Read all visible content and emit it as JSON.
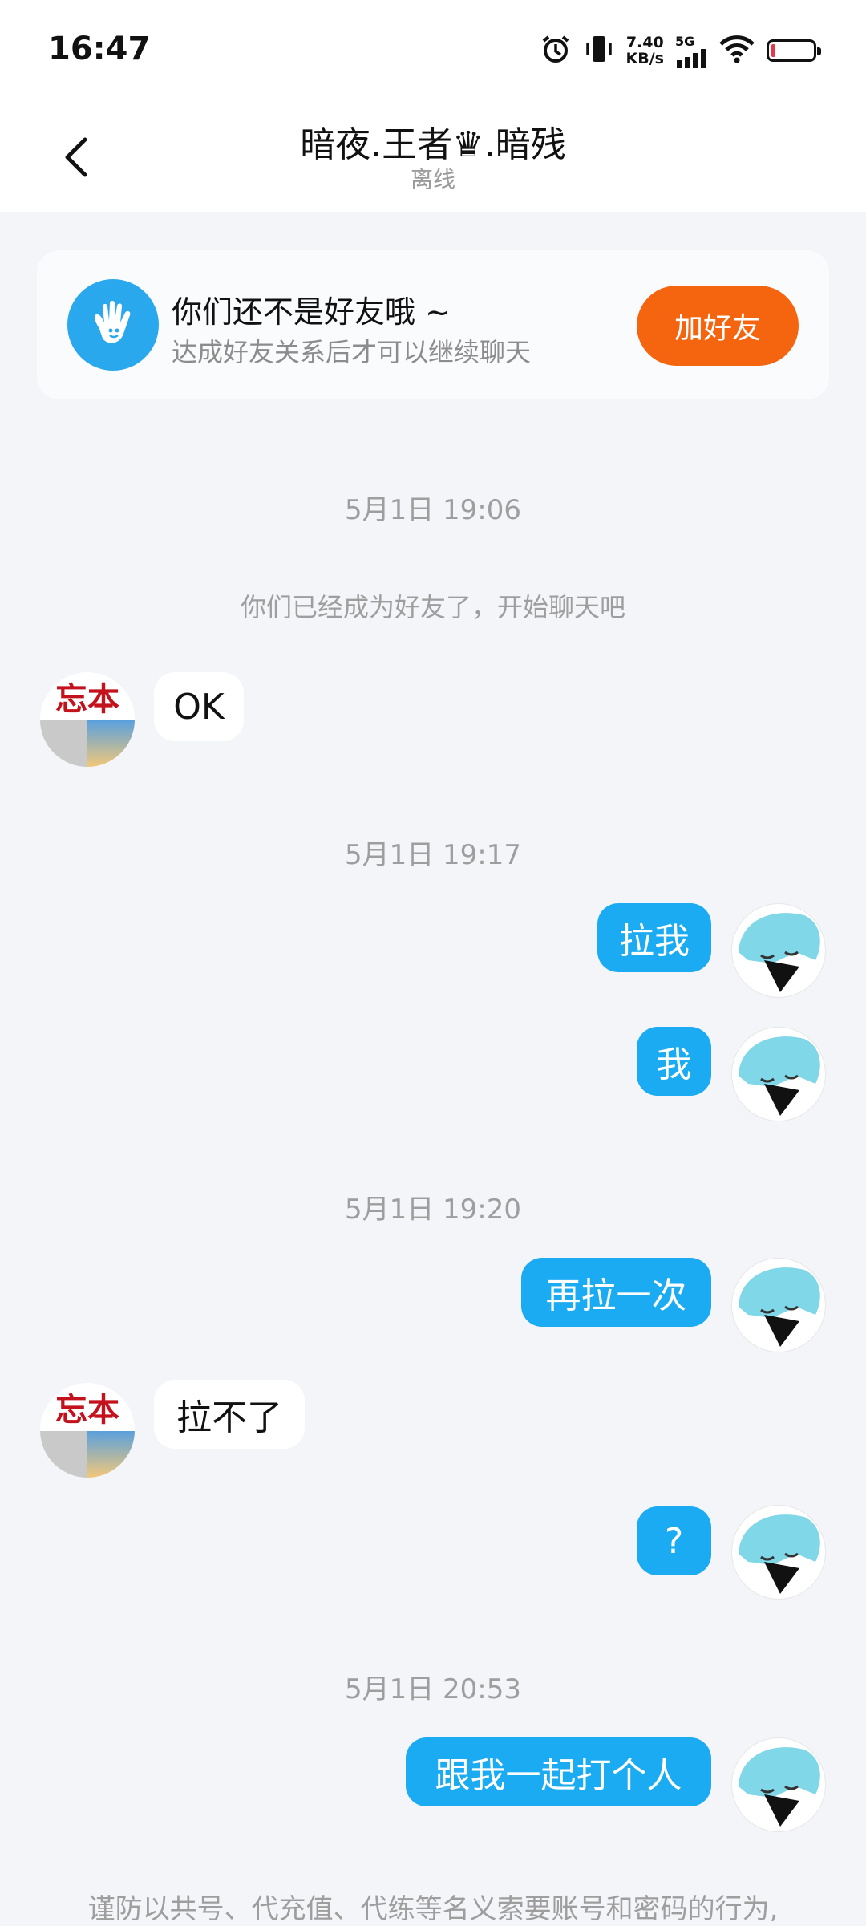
{
  "status_bar": {
    "time": "16:47",
    "net_speed_value": "7.40",
    "net_speed_unit": "KB/s",
    "network": "5G",
    "icons": [
      "alarm-icon",
      "vibrate-icon",
      "signal-icon",
      "wifi-icon",
      "battery-icon"
    ],
    "battery_color": "#e23a4b"
  },
  "header": {
    "title": "暗夜.王者♛.暗残",
    "subtitle": "离线"
  },
  "friend_card": {
    "title": "你们还不是好友哦 ~",
    "subtitle": "达成好友关系后才可以继续聊天",
    "button": "加好友",
    "button_color": "#f5640f"
  },
  "chat": {
    "timestamps": [
      "5月1日 19:06",
      "5月1日 19:17",
      "5月1日 19:20",
      "5月1日 20:53"
    ],
    "system_message": "你们已经成为好友了，开始聊天吧",
    "messages": [
      {
        "side": "in",
        "text": "OK"
      },
      {
        "side": "out",
        "text": "拉我"
      },
      {
        "side": "out",
        "text": "我"
      },
      {
        "side": "out",
        "text": "再拉一次"
      },
      {
        "side": "in",
        "text": "拉不了"
      },
      {
        "side": "out",
        "text": "?"
      },
      {
        "side": "out",
        "text": "跟我一起打个人"
      }
    ],
    "left_avatar_text": "忘本",
    "bubble_out_color": "#1aabf2"
  },
  "notice": "谨防以共号、代充值、代练等名义索要账号和密码的行为,"
}
